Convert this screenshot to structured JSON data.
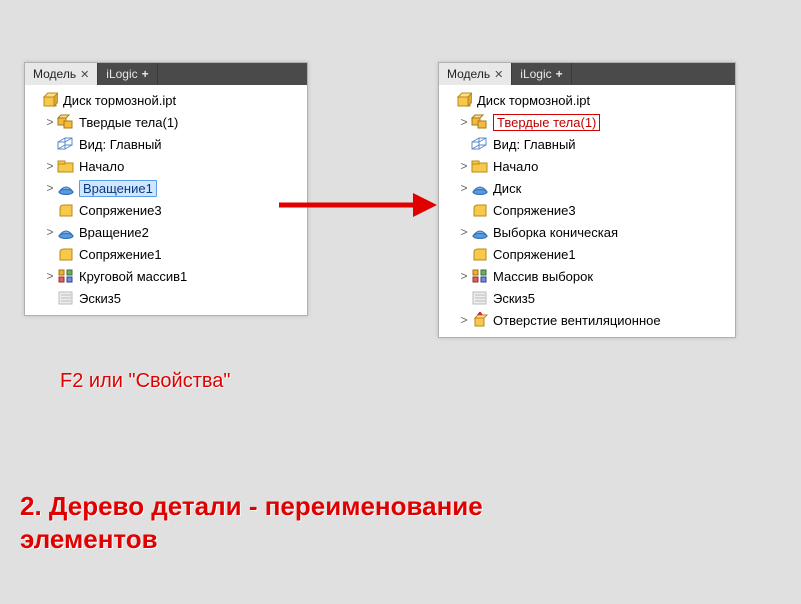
{
  "tabs": {
    "active": "Модель",
    "inactive": "iLogic"
  },
  "leftPanel": {
    "root": "Диск тормозной.ipt",
    "items": [
      {
        "label": "Твердые тела(1)",
        "icon": "bodies",
        "expander": ">"
      },
      {
        "label": "Вид: Главный",
        "icon": "view",
        "expander": ""
      },
      {
        "label": "Начало",
        "icon": "folder",
        "expander": ">"
      },
      {
        "label": "Вращение1",
        "icon": "revolve",
        "expander": ">",
        "selected": "blue"
      },
      {
        "label": "Сопряжение3",
        "icon": "fillet",
        "expander": ""
      },
      {
        "label": "Вращение2",
        "icon": "revolve",
        "expander": ">"
      },
      {
        "label": "Сопряжение1",
        "icon": "fillet",
        "expander": ""
      },
      {
        "label": "Круговой массив1",
        "icon": "pattern",
        "expander": ">"
      },
      {
        "label": "Эскиз5",
        "icon": "sketch",
        "expander": ""
      }
    ]
  },
  "rightPanel": {
    "root": "Диск тормозной.ipt",
    "items": [
      {
        "label": "Твердые тела(1)",
        "icon": "bodies",
        "expander": ">",
        "selected": "red"
      },
      {
        "label": "Вид: Главный",
        "icon": "view",
        "expander": ""
      },
      {
        "label": "Начало",
        "icon": "folder",
        "expander": ">"
      },
      {
        "label": "Диск",
        "icon": "revolve",
        "expander": ">"
      },
      {
        "label": "Сопряжение3",
        "icon": "fillet",
        "expander": ""
      },
      {
        "label": "Выборка коническая",
        "icon": "revolve",
        "expander": ">"
      },
      {
        "label": "Сопряжение1",
        "icon": "fillet",
        "expander": ""
      },
      {
        "label": "Массив выборок",
        "icon": "pattern",
        "expander": ">"
      },
      {
        "label": "Эскиз5",
        "icon": "sketch",
        "expander": ""
      },
      {
        "label": "Отверстие вентиляционное",
        "icon": "extrude",
        "expander": ">"
      }
    ]
  },
  "captions": {
    "hint": "F2 или \"Свойства\"",
    "title": "2. Дерево детали - переименование элементов"
  },
  "colors": {
    "red": "#e00000"
  }
}
